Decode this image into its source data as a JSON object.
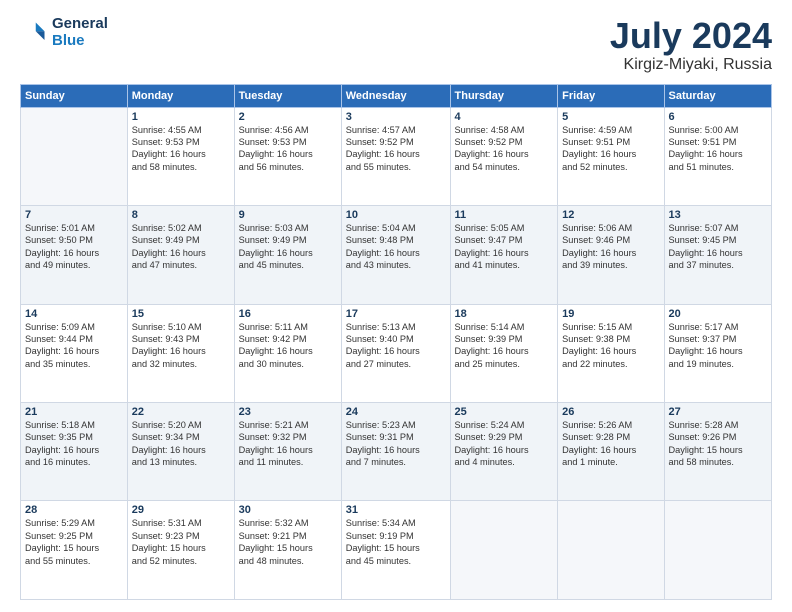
{
  "header": {
    "logo_line1": "General",
    "logo_line2": "Blue",
    "month": "July 2024",
    "location": "Kirgiz-Miyaki, Russia"
  },
  "columns": [
    "Sunday",
    "Monday",
    "Tuesday",
    "Wednesday",
    "Thursday",
    "Friday",
    "Saturday"
  ],
  "weeks": [
    [
      {
        "day": "",
        "info": ""
      },
      {
        "day": "1",
        "info": "Sunrise: 4:55 AM\nSunset: 9:53 PM\nDaylight: 16 hours\nand 58 minutes."
      },
      {
        "day": "2",
        "info": "Sunrise: 4:56 AM\nSunset: 9:53 PM\nDaylight: 16 hours\nand 56 minutes."
      },
      {
        "day": "3",
        "info": "Sunrise: 4:57 AM\nSunset: 9:52 PM\nDaylight: 16 hours\nand 55 minutes."
      },
      {
        "day": "4",
        "info": "Sunrise: 4:58 AM\nSunset: 9:52 PM\nDaylight: 16 hours\nand 54 minutes."
      },
      {
        "day": "5",
        "info": "Sunrise: 4:59 AM\nSunset: 9:51 PM\nDaylight: 16 hours\nand 52 minutes."
      },
      {
        "day": "6",
        "info": "Sunrise: 5:00 AM\nSunset: 9:51 PM\nDaylight: 16 hours\nand 51 minutes."
      }
    ],
    [
      {
        "day": "7",
        "info": "Sunrise: 5:01 AM\nSunset: 9:50 PM\nDaylight: 16 hours\nand 49 minutes."
      },
      {
        "day": "8",
        "info": "Sunrise: 5:02 AM\nSunset: 9:49 PM\nDaylight: 16 hours\nand 47 minutes."
      },
      {
        "day": "9",
        "info": "Sunrise: 5:03 AM\nSunset: 9:49 PM\nDaylight: 16 hours\nand 45 minutes."
      },
      {
        "day": "10",
        "info": "Sunrise: 5:04 AM\nSunset: 9:48 PM\nDaylight: 16 hours\nand 43 minutes."
      },
      {
        "day": "11",
        "info": "Sunrise: 5:05 AM\nSunset: 9:47 PM\nDaylight: 16 hours\nand 41 minutes."
      },
      {
        "day": "12",
        "info": "Sunrise: 5:06 AM\nSunset: 9:46 PM\nDaylight: 16 hours\nand 39 minutes."
      },
      {
        "day": "13",
        "info": "Sunrise: 5:07 AM\nSunset: 9:45 PM\nDaylight: 16 hours\nand 37 minutes."
      }
    ],
    [
      {
        "day": "14",
        "info": "Sunrise: 5:09 AM\nSunset: 9:44 PM\nDaylight: 16 hours\nand 35 minutes."
      },
      {
        "day": "15",
        "info": "Sunrise: 5:10 AM\nSunset: 9:43 PM\nDaylight: 16 hours\nand 32 minutes."
      },
      {
        "day": "16",
        "info": "Sunrise: 5:11 AM\nSunset: 9:42 PM\nDaylight: 16 hours\nand 30 minutes."
      },
      {
        "day": "17",
        "info": "Sunrise: 5:13 AM\nSunset: 9:40 PM\nDaylight: 16 hours\nand 27 minutes."
      },
      {
        "day": "18",
        "info": "Sunrise: 5:14 AM\nSunset: 9:39 PM\nDaylight: 16 hours\nand 25 minutes."
      },
      {
        "day": "19",
        "info": "Sunrise: 5:15 AM\nSunset: 9:38 PM\nDaylight: 16 hours\nand 22 minutes."
      },
      {
        "day": "20",
        "info": "Sunrise: 5:17 AM\nSunset: 9:37 PM\nDaylight: 16 hours\nand 19 minutes."
      }
    ],
    [
      {
        "day": "21",
        "info": "Sunrise: 5:18 AM\nSunset: 9:35 PM\nDaylight: 16 hours\nand 16 minutes."
      },
      {
        "day": "22",
        "info": "Sunrise: 5:20 AM\nSunset: 9:34 PM\nDaylight: 16 hours\nand 13 minutes."
      },
      {
        "day": "23",
        "info": "Sunrise: 5:21 AM\nSunset: 9:32 PM\nDaylight: 16 hours\nand 11 minutes."
      },
      {
        "day": "24",
        "info": "Sunrise: 5:23 AM\nSunset: 9:31 PM\nDaylight: 16 hours\nand 7 minutes."
      },
      {
        "day": "25",
        "info": "Sunrise: 5:24 AM\nSunset: 9:29 PM\nDaylight: 16 hours\nand 4 minutes."
      },
      {
        "day": "26",
        "info": "Sunrise: 5:26 AM\nSunset: 9:28 PM\nDaylight: 16 hours\nand 1 minute."
      },
      {
        "day": "27",
        "info": "Sunrise: 5:28 AM\nSunset: 9:26 PM\nDaylight: 15 hours\nand 58 minutes."
      }
    ],
    [
      {
        "day": "28",
        "info": "Sunrise: 5:29 AM\nSunset: 9:25 PM\nDaylight: 15 hours\nand 55 minutes."
      },
      {
        "day": "29",
        "info": "Sunrise: 5:31 AM\nSunset: 9:23 PM\nDaylight: 15 hours\nand 52 minutes."
      },
      {
        "day": "30",
        "info": "Sunrise: 5:32 AM\nSunset: 9:21 PM\nDaylight: 15 hours\nand 48 minutes."
      },
      {
        "day": "31",
        "info": "Sunrise: 5:34 AM\nSunset: 9:19 PM\nDaylight: 15 hours\nand 45 minutes."
      },
      {
        "day": "",
        "info": ""
      },
      {
        "day": "",
        "info": ""
      },
      {
        "day": "",
        "info": ""
      }
    ]
  ]
}
